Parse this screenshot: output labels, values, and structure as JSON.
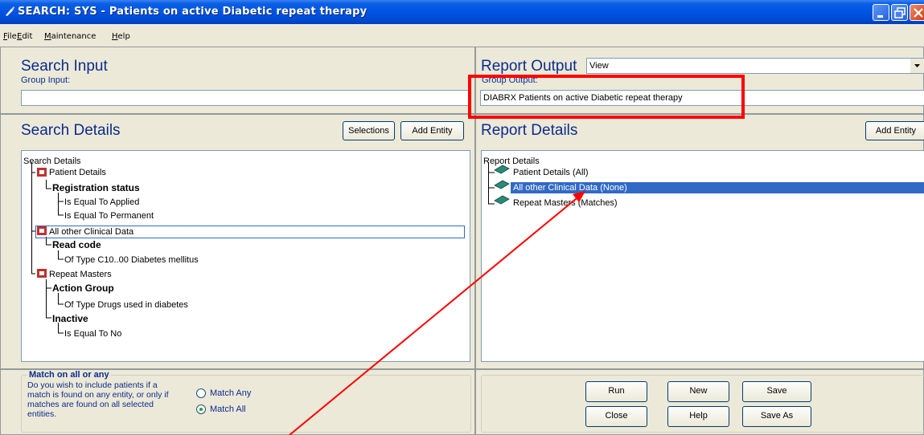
{
  "window": {
    "title": "SEARCH: SYS - Patients on active Diabetic repeat therapy"
  },
  "menu": [
    "File",
    "Edit",
    "Maintenance",
    "Help"
  ],
  "search_input": {
    "heading": "Search Input",
    "group_label": "Group Input:",
    "group_value": ""
  },
  "report_output": {
    "heading": "Report Output",
    "view_value": "View",
    "group_label": "Group Output:",
    "group_value": "DIABRX Patients on active Diabetic repeat therapy"
  },
  "search_details": {
    "heading": "Search Details",
    "selections_button": "Selections",
    "add_entity_button": "Add Entity",
    "tree": [
      "Search Details",
      "Patient Details",
      "Registration status",
      "Is Equal To Applied",
      "Is Equal To Permanent",
      "All other Clinical Data",
      "Read code",
      "Of Type C10..00   Diabetes mellitus",
      "Repeat Masters",
      "Action Group",
      "Of Type Drugs used in diabetes",
      "Inactive",
      "Is Equal To No"
    ]
  },
  "report_details": {
    "heading": "Report Details",
    "add_entity_button": "Add Entity",
    "tree": [
      "Report Details",
      "Patient Details (All)",
      "All other Clinical Data (None)",
      "Repeat Masters (Matches)"
    ]
  },
  "match": {
    "legend": "Match on all or any",
    "description": [
      "Do you wish to include patients if a",
      "match is found on any entity, or only if",
      "matches are found on all selected",
      "entities."
    ],
    "options": [
      "Match Any",
      "Match All"
    ],
    "selected": "Match All"
  },
  "actions": {
    "run": "Run",
    "new": "New",
    "save": "Save",
    "close": "Close",
    "help": "Help",
    "save_as": "Save As"
  },
  "annotation": {
    "highlight_color": "#ff0000"
  }
}
